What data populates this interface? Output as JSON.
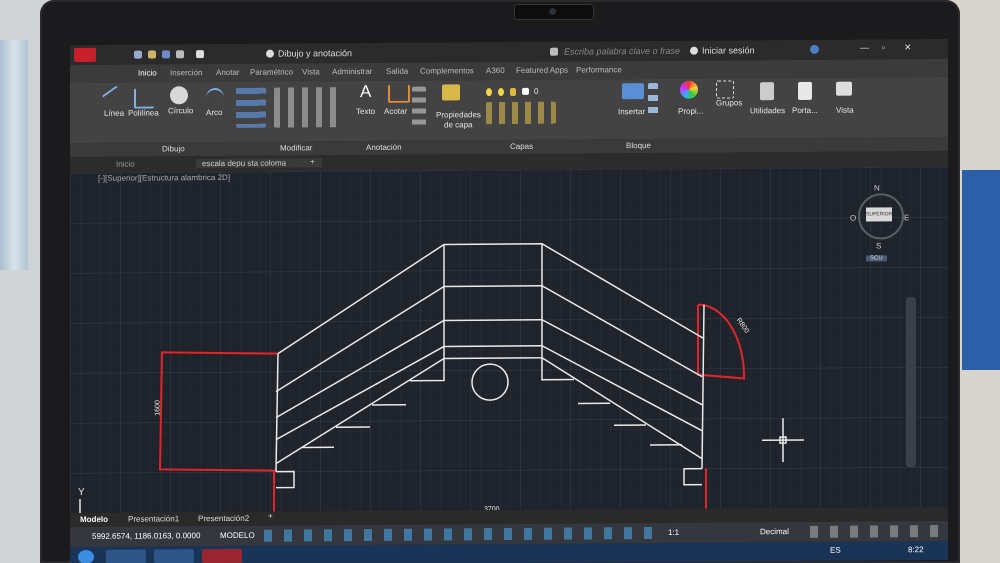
{
  "titlebar": {
    "workspace": "Dibujo y anotación",
    "search_placeholder": "Escriba palabra clave o frase",
    "signin": "Iniciar sesión"
  },
  "ribbon_tabs": [
    "Inicio",
    "Inserción",
    "Anotar",
    "Paramétrico",
    "Vista",
    "Administrar",
    "Salida",
    "Complementos",
    "A360",
    "Featured Apps",
    "Performance"
  ],
  "ribbon_tools": {
    "linea": "Línea",
    "polilinea": "Polilínea",
    "circulo": "Círculo",
    "arco": "Arco",
    "texto": "Texto",
    "acotar": "Acotar",
    "propiedades_capa_1": "Propiedades",
    "propiedades_capa_2": "de capa",
    "layer_num": "0",
    "insertar": "Insertar",
    "propi": "Propi...",
    "grupos": "Grupos",
    "utilidades": "Utilidades",
    "porta": "Porta...",
    "vista": "Vista"
  },
  "panel_titles": {
    "dibujo": "Dibujo",
    "modificar": "Modificar",
    "anotacion": "Anotación",
    "capas": "Capas",
    "bloque": "Bloque"
  },
  "doc_tabs": {
    "inicio": "Inicio",
    "active": "escala depu sta coloma"
  },
  "viewport_label": "[-][Superior][Estructura alambrica 2D]",
  "viewcube": {
    "n": "N",
    "s": "S",
    "e": "E",
    "o": "O",
    "face": "SUPERIOR",
    "wcs": "SCU"
  },
  "dimensions": {
    "bottom": "3700",
    "left": "1600",
    "arc": "R800"
  },
  "layout_tabs": [
    "Modelo",
    "Presentación1",
    "Presentación2"
  ],
  "status": {
    "coords": "5992.6574, 1186.0163, 0.0000",
    "mode": "MODELO",
    "scale": "1:1",
    "units": "Decimal"
  },
  "taskbar": {
    "lang": "ES",
    "time": "8:22"
  },
  "colors": {
    "drawing_bg": "#1f232b",
    "grid": "#2d3440",
    "white_lines": "#e8e8e8",
    "red_lines": "#e0262a",
    "ribbon": "#434343"
  }
}
